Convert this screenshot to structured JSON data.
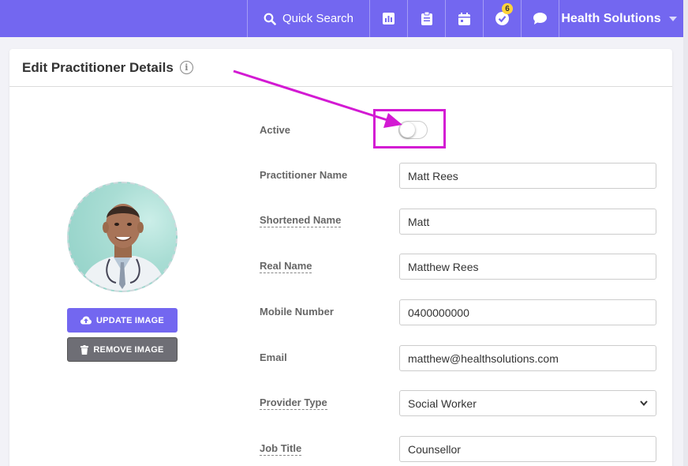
{
  "topbar": {
    "quick_search_label": "Quick Search",
    "notification_count": "6",
    "org_name": "Health Solutions",
    "icons": [
      "search-icon",
      "chart-icon",
      "clipboard-icon",
      "calendar-icon",
      "check-circle-icon",
      "chat-icon",
      "chevron-down-icon"
    ]
  },
  "card": {
    "title": "Edit Practitioner Details"
  },
  "image_buttons": {
    "update_label": "UPDATE IMAGE",
    "remove_label": "REMOVE IMAGE"
  },
  "form": {
    "active": {
      "label": "Active",
      "value": false
    },
    "practitioner_name": {
      "label": "Practitioner Name",
      "value": "Matt Rees"
    },
    "shortened_name": {
      "label": "Shortened Name",
      "value": "Matt"
    },
    "real_name": {
      "label": "Real Name",
      "value": "Matthew Rees"
    },
    "mobile_number": {
      "label": "Mobile Number",
      "value": "0400000000"
    },
    "email": {
      "label": "Email",
      "value": "matthew@healthsolutions.com"
    },
    "provider_type": {
      "label": "Provider Type",
      "value": "Social Worker"
    },
    "job_title": {
      "label": "Job Title",
      "value": "Counsellor"
    }
  },
  "colors": {
    "primary": "#7367f0",
    "secondary": "#6e6e75",
    "annotation": "#d31ad3",
    "badge": "#ffd43b"
  }
}
